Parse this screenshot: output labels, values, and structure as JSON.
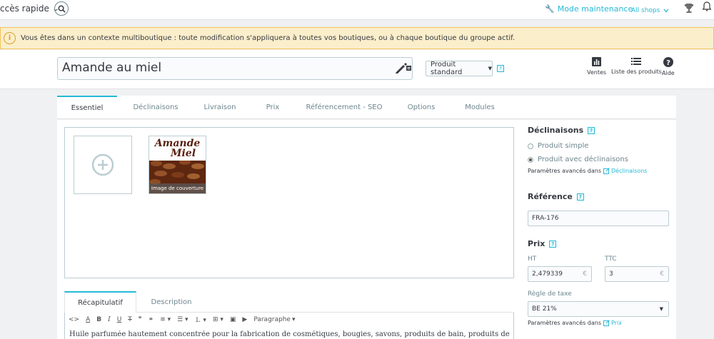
{
  "topbar": {
    "quick_access": "ccès rapide",
    "maintenance": "Mode maintenance",
    "shops": "All shops"
  },
  "alert": {
    "message": "Vous êtes dans un contexte multiboutique : toute modification s'appliquera à toutes vos boutiques, ou à chaque boutique du groupe actif."
  },
  "product": {
    "name": "Amande au miel",
    "type": "Produit standard"
  },
  "header_actions": [
    {
      "label": "Ventes",
      "icon": "bar-chart-icon"
    },
    {
      "label": "Liste des produits",
      "icon": "list-icon"
    },
    {
      "label": "Aide",
      "icon": "help-circle-icon"
    }
  ],
  "tabs": [
    "Essentiel",
    "Déclinaisons",
    "Livraison",
    "Prix",
    "Référencement - SEO",
    "Options",
    "Modules"
  ],
  "images": {
    "cover_logo_line1": "Amande",
    "cover_logo_line2": "Miel",
    "cover_caption": "Image de couverture"
  },
  "summary_tabs": [
    "Récapitulatif",
    "Description"
  ],
  "editor": {
    "format_select": "Paragraphe",
    "text": "Huile parfumée hautement concentrée pour la fabrication de cosmétiques, bougies, savons, produits de bain, produits de nettoyage, désodorisants, plâtres"
  },
  "declinaisons": {
    "title": "Déclinaisons",
    "option_simple": "Produit simple",
    "option_variants": "Produit avec déclinaisons",
    "advanced_prefix": "Paramètres avancés dans",
    "advanced_link": "Déclinaisons"
  },
  "reference": {
    "title": "Référence",
    "value": "FRA-176"
  },
  "prix": {
    "title": "Prix",
    "ht_label": "HT",
    "ttc_label": "TTC",
    "ht_value": "2,479339",
    "ttc_value": "3",
    "currency": "€",
    "tax_label": "Règle de taxe",
    "tax_value": "BE 21%",
    "advanced_prefix": "Paramètres avancés dans",
    "advanced_link": "Prix"
  },
  "colors": {
    "accent": "#25b9d7",
    "alert_bg": "#fbeecb",
    "alert_border": "#f5c35a"
  }
}
